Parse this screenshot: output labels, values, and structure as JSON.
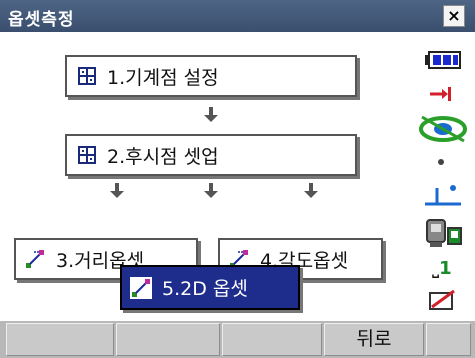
{
  "window": {
    "title": "옵셋측정",
    "close_label": "×"
  },
  "menu": {
    "items": [
      {
        "label": "1.기계점 설정",
        "icon": "grid-icon"
      },
      {
        "label": "2.후시점 셋업",
        "icon": "grid-icon"
      },
      {
        "label": "3.거리옵셋",
        "icon": "offset-point-icon"
      },
      {
        "label": "4.각도옵셋",
        "icon": "offset-point-icon"
      },
      {
        "label": "5.2D 옵셋",
        "icon": "offset-point-icon",
        "selected": true
      }
    ]
  },
  "status_icons": [
    "battery-icon",
    "target-arrow-icon",
    "compensator-icon",
    "dot-icon",
    "prism-constant-icon",
    "instrument-icon",
    "face-icon",
    "laser-icon"
  ],
  "status": {
    "face_number": "1"
  },
  "softkeys": [
    "",
    "",
    "",
    "뒤로",
    ""
  ],
  "colors": {
    "titlebar": "#3e5373",
    "selected": "#1e2d8c",
    "accent_red": "#d0202a",
    "accent_green": "#2aa02a",
    "battery_blue": "#1a2ad0"
  }
}
